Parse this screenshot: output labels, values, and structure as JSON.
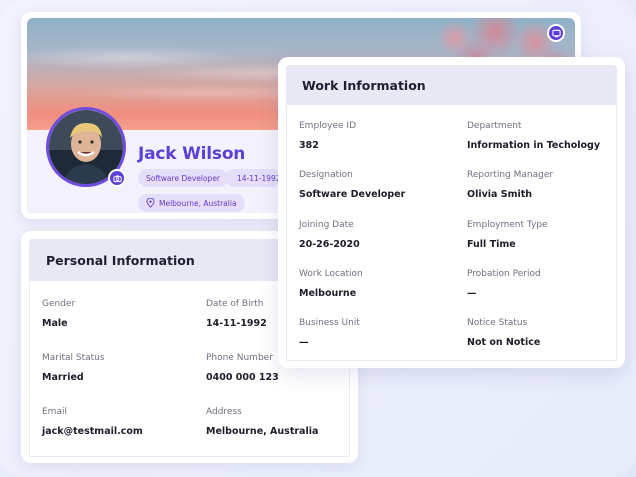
{
  "profile": {
    "name": "Jack Wilson",
    "role": "Software Developer",
    "date_of_birth": "14-11-1992",
    "location": "Melbourne, Australia"
  },
  "personal_info": {
    "title": "Personal Information",
    "fields": [
      {
        "label": "Gender",
        "value": "Male"
      },
      {
        "label": "Date of Birth",
        "value": "14-11-1992"
      },
      {
        "label": "Marital Status",
        "value": "Married"
      },
      {
        "label": "Phone Number",
        "value": "0400 000 123"
      },
      {
        "label": "Email",
        "value": "jack@testmail.com"
      },
      {
        "label": "Address",
        "value": "Melbourne, Australia"
      }
    ]
  },
  "work_info": {
    "title": "Work Information",
    "fields": [
      {
        "label": "Employee ID",
        "value": "382"
      },
      {
        "label": "Department",
        "value": "Information in Techology"
      },
      {
        "label": "Designation",
        "value": "Software Developer"
      },
      {
        "label": "Reporting Manager",
        "value": "Olivia Smith"
      },
      {
        "label": "Joining Date",
        "value": "20-26-2020"
      },
      {
        "label": "Employment Type",
        "value": "Full Time"
      },
      {
        "label": "Work Location",
        "value": "Melbourne"
      },
      {
        "label": "Probation Period",
        "value": "—"
      },
      {
        "label": "Business Unit",
        "value": "—"
      },
      {
        "label": "Notice Status",
        "value": "Not on Notice"
      }
    ]
  },
  "theme": {
    "accent": "#5b3fd6",
    "chip_bg": "#e4defa",
    "header_bg": "#e8e8f5"
  },
  "icons": {
    "cover_edit": "image-edit-icon",
    "avatar_camera": "camera-icon",
    "dob_chip": "calendar-icon",
    "location_chip": "map-pin-icon"
  }
}
